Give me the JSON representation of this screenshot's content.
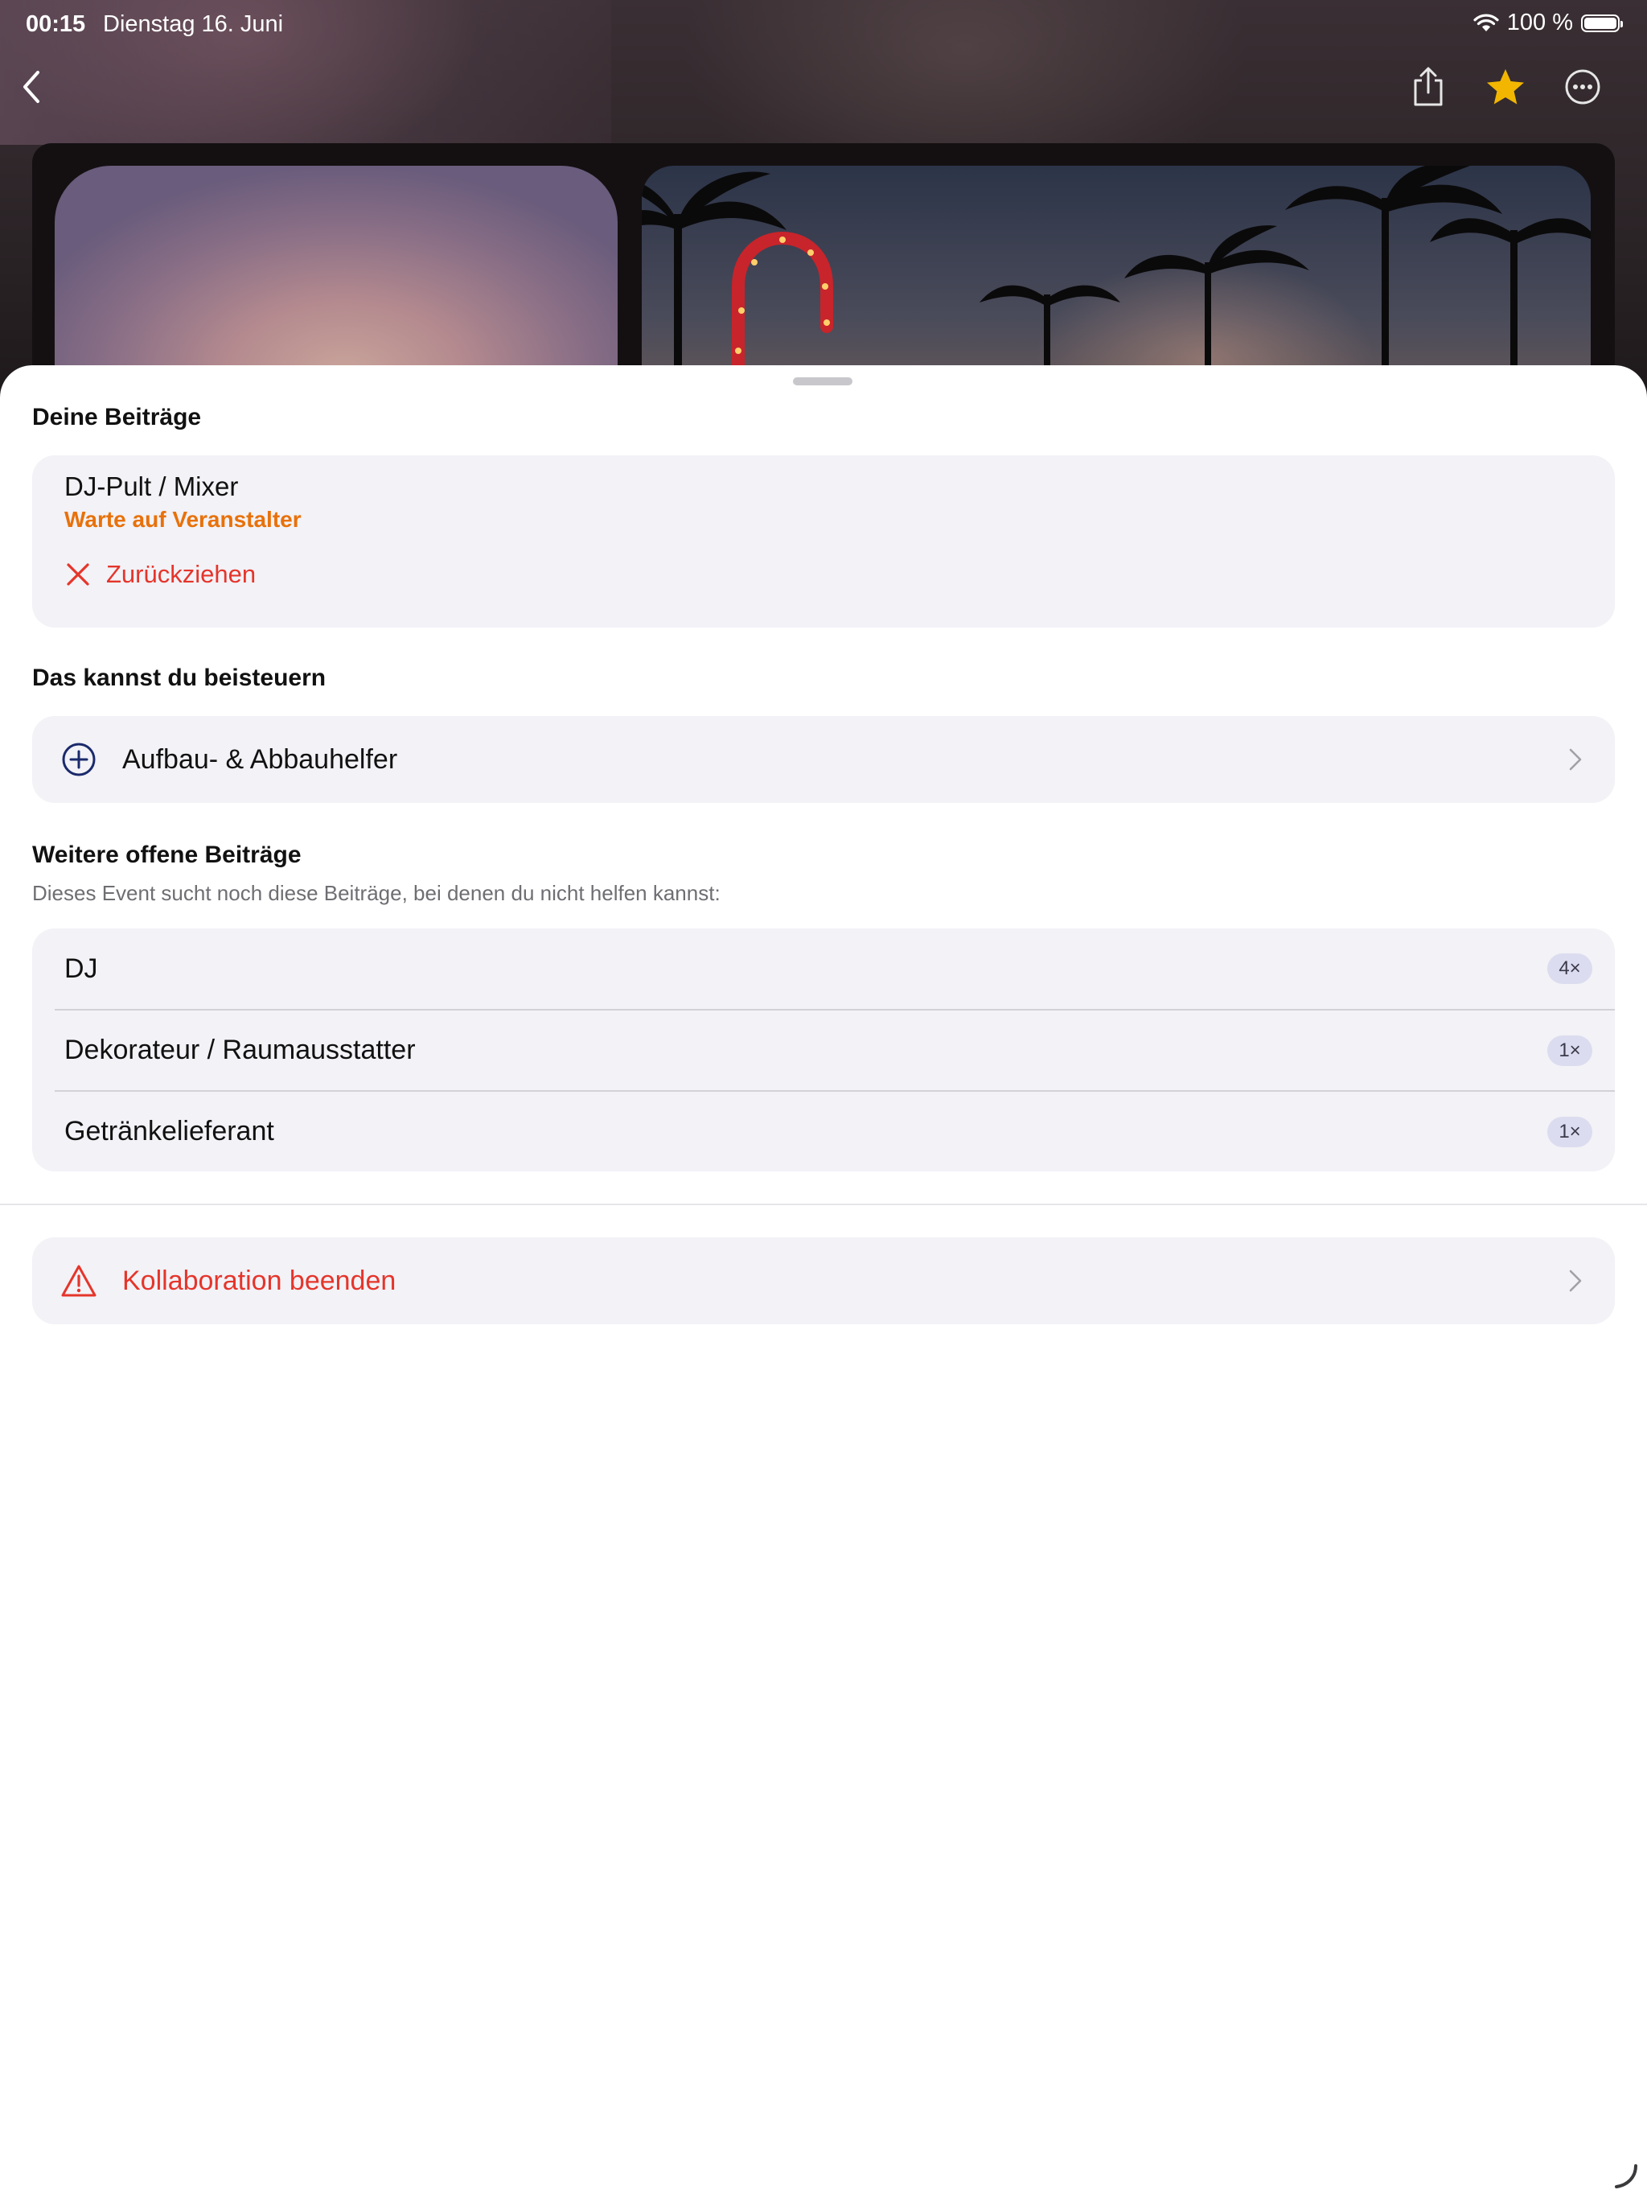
{
  "statusbar": {
    "time": "00:15",
    "date": "Dienstag 16. Juni",
    "battery": "100 %"
  },
  "nav": {
    "back_icon": "chevron-left-icon",
    "share_icon": "share-icon",
    "favorite_icon": "star-icon",
    "more_icon": "ellipsis-circle-icon",
    "favorite_color": "#F2B600"
  },
  "sections": {
    "your_contributions": {
      "title": "Deine Beiträge",
      "item": {
        "title": "DJ-Pult / Mixer",
        "status": "Warte auf Veranstalter",
        "status_color": "#E8710A",
        "withdraw_label": "Zurückziehen"
      }
    },
    "can_contribute": {
      "title": "Das kannst du beisteuern",
      "items": [
        {
          "label": "Aufbau- & Abbauhelfer"
        }
      ]
    },
    "other_open": {
      "title": "Weitere offene Beiträge",
      "subtitle": "Dieses Event sucht noch diese Beiträge, bei denen du nicht helfen kannst:",
      "items": [
        {
          "label": "DJ",
          "count": "4×"
        },
        {
          "label": "Dekorateur / Raumausstatter",
          "count": "1×"
        },
        {
          "label": "Getränkelieferant",
          "count": "1×"
        }
      ]
    },
    "end_collaboration": {
      "label": "Kollaboration beenden",
      "color": "#E5352B"
    }
  },
  "colors": {
    "destructive": "#E5352B",
    "accent_navy": "#1B2A6B"
  }
}
